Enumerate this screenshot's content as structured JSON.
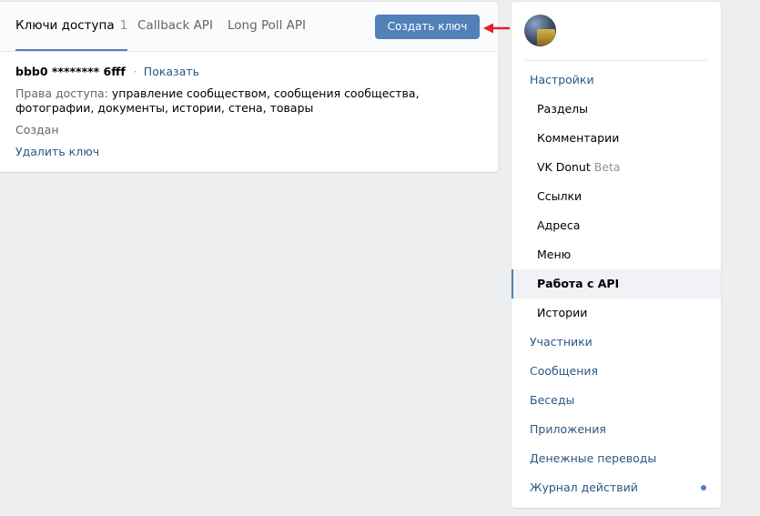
{
  "tabs": [
    {
      "label": "Ключи доступа",
      "count": "1"
    },
    {
      "label": "Callback API"
    },
    {
      "label": "Long Poll API"
    }
  ],
  "create_button": "Создать ключ",
  "key": {
    "name": "bbb0 ******** 6fff",
    "separator": "·",
    "show_link": "Показать",
    "rights_label": "Права доступа:",
    "rights_value": "управление сообществом, сообщения сообщества, фотографии, документы, истории, стена, товары",
    "created_label": "Создан",
    "delete_link": "Удалить ключ"
  },
  "sidebar": {
    "items": [
      {
        "label": "Настройки",
        "level": "top"
      },
      {
        "label": "Разделы",
        "level": "sub"
      },
      {
        "label": "Комментарии",
        "level": "sub"
      },
      {
        "label": "VK Donut",
        "level": "sub",
        "badge": "Beta"
      },
      {
        "label": "Ссылки",
        "level": "sub"
      },
      {
        "label": "Адреса",
        "level": "sub"
      },
      {
        "label": "Меню",
        "level": "sub"
      },
      {
        "label": "Работа с API",
        "level": "sub",
        "active": true
      },
      {
        "label": "Истории",
        "level": "sub"
      },
      {
        "label": "Участники",
        "level": "top"
      },
      {
        "label": "Сообщения",
        "level": "top"
      },
      {
        "label": "Беседы",
        "level": "top"
      },
      {
        "label": "Приложения",
        "level": "top"
      },
      {
        "label": "Денежные переводы",
        "level": "top"
      },
      {
        "label": "Журнал действий",
        "level": "top",
        "notification": true
      }
    ]
  },
  "colors": {
    "accent": "#5181b8",
    "link": "#2a5885",
    "arrow": "#e21f26",
    "background": "#edeef0"
  },
  "icons": {
    "arrow": "arrow-left-icon",
    "avatar": "community-avatar",
    "notification": "notification-dot-icon"
  }
}
